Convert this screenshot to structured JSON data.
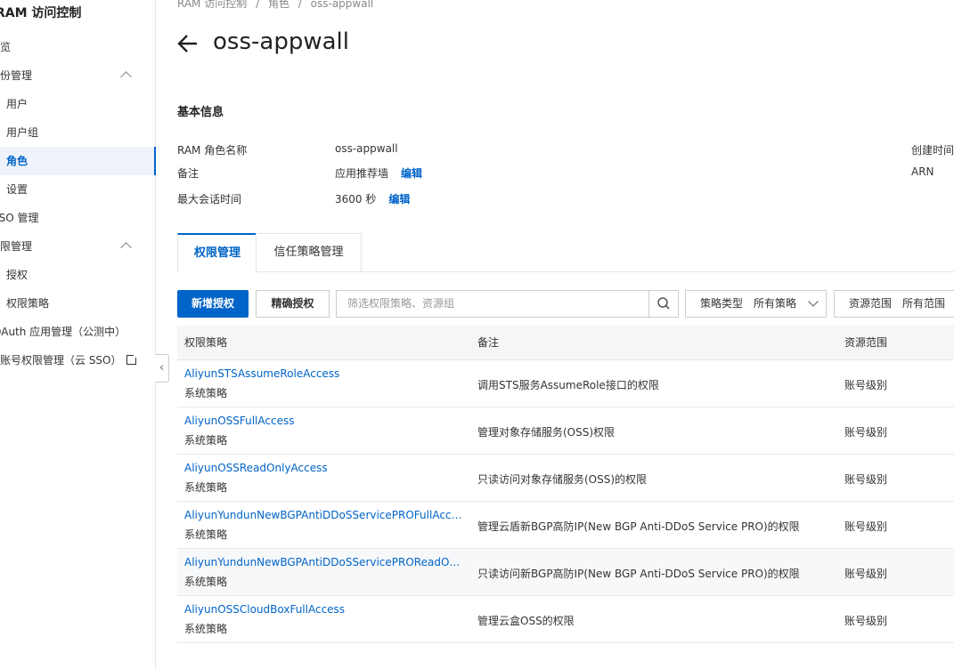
{
  "sidebar": {
    "title": "RAM 访问控制",
    "items": [
      {
        "label": "概览"
      },
      {
        "label": "身份管理"
      },
      {
        "label": "用户"
      },
      {
        "label": "用户组"
      },
      {
        "label": "角色"
      },
      {
        "label": "设置"
      },
      {
        "label": "SSO 管理"
      },
      {
        "label": "权限管理"
      },
      {
        "label": "授权"
      },
      {
        "label": "权限策略"
      },
      {
        "label": "OAuth 应用管理（公测中）"
      },
      {
        "label": "多账号权限管理（云 SSO）"
      }
    ],
    "active": "角色",
    "collapse_glyph": "‹"
  },
  "breadcrumb": [
    "RAM 访问控制",
    "/",
    "角色",
    "/",
    "oss-appwall"
  ],
  "page": {
    "title": "oss-appwall"
  },
  "basic_info": {
    "heading": "基本信息",
    "role_name_label": "RAM 角色名称",
    "role_name_value": "oss-appwall",
    "note_label": "备注",
    "note_value": "应用推荐墙",
    "max_session_label": "最大会话时间",
    "max_session_value": "3600 秒",
    "edit_label": "编辑",
    "created_label": "创建时间",
    "arn_label": "ARN"
  },
  "tabs": [
    {
      "label": "权限管理",
      "active": true
    },
    {
      "label": "信任策略管理",
      "active": false
    }
  ],
  "toolbar": {
    "add_label": "新增授权",
    "precise_label": "精确授权",
    "search_placeholder": "筛选权限策略、资源组",
    "policy_type_label": "策略类型",
    "policy_type_value": "所有策略",
    "scope_label": "资源范围",
    "scope_value": "所有范围"
  },
  "table": {
    "headers": [
      "权限策略",
      "备注",
      "资源范围"
    ],
    "rows": [
      {
        "name": "AliyunSTSAssumeRoleAccess",
        "type": "系统策略",
        "note": "调用STS服务AssumeRole接口的权限",
        "scope": "账号级别"
      },
      {
        "name": "AliyunOSSFullAccess",
        "type": "系统策略",
        "note": "管理对象存储服务(OSS)权限",
        "scope": "账号级别"
      },
      {
        "name": "AliyunOSSReadOnlyAccess",
        "type": "系统策略",
        "note": "只读访问对象存储服务(OSS)的权限",
        "scope": "账号级别"
      },
      {
        "name": "AliyunYundunNewBGPAntiDDoSServicePROFullAccess",
        "type": "系统策略",
        "note": "管理云盾新BGP高防IP(New BGP Anti-DDoS Service PRO)的权限",
        "scope": "账号级别"
      },
      {
        "name": "AliyunYundunNewBGPAntiDDoSServicePROReadOnlyAcc...",
        "type": "系统策略",
        "note": "只读访问新BGP高防IP(New BGP Anti-DDoS Service PRO)的权限",
        "scope": "账号级别"
      },
      {
        "name": "AliyunOSSCloudBoxFullAccess",
        "type": "系统策略",
        "note": "管理云盒OSS的权限",
        "scope": "账号级别"
      }
    ]
  },
  "colors": {
    "accent": "#0064c8",
    "text": "#333333",
    "muted": "#888888"
  },
  "icons": [
    "back-arrow-icon",
    "chevron-up-icon",
    "external-link-icon",
    "search-icon",
    "chevron-down-icon",
    "collapse-icon"
  ]
}
